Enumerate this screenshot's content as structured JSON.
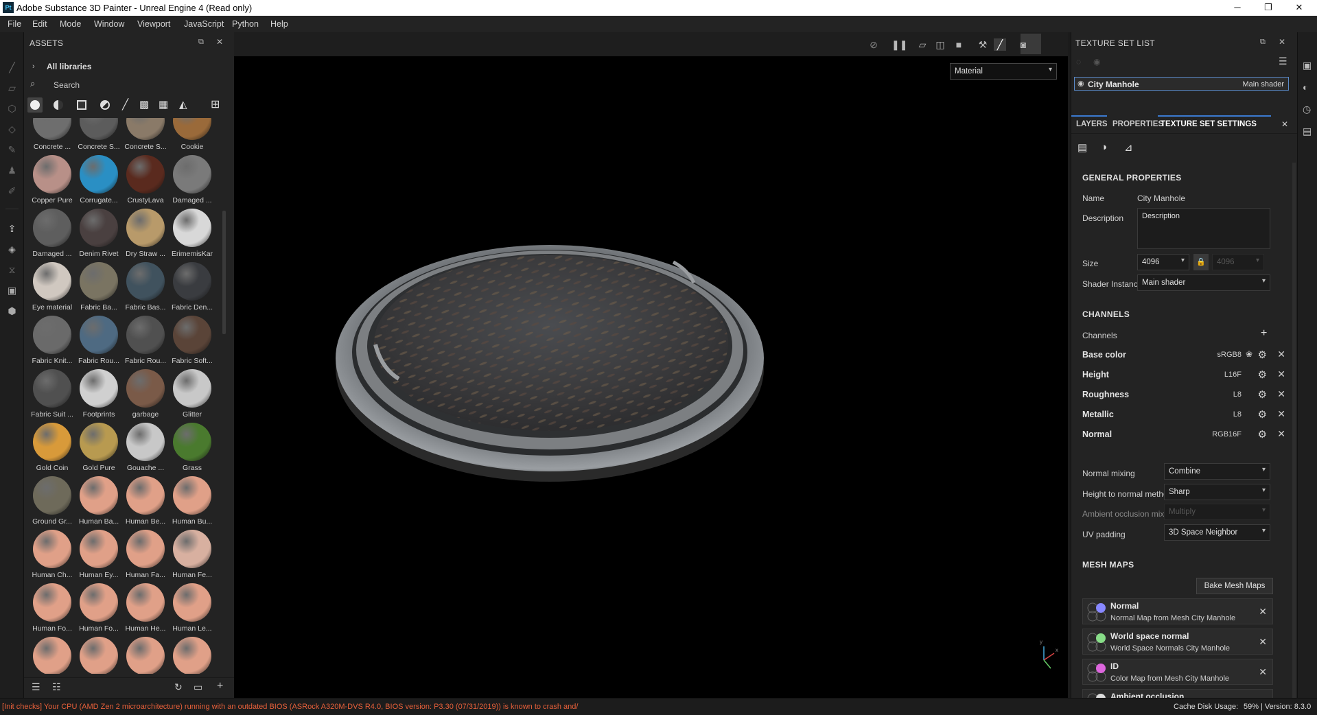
{
  "window": {
    "title": "Adobe Substance 3D Painter - Unreal Engine 4 (Read only)",
    "app_icon": "Pt",
    "minimize": "─",
    "maximize": "❐",
    "close": "✕"
  },
  "menu": [
    "File",
    "Edit",
    "Mode",
    "Window",
    "Viewport",
    "JavaScript",
    "Python",
    "Help"
  ],
  "assets": {
    "title": "ASSETS",
    "breadcrumb": "All libraries",
    "search_placeholder": "Search",
    "items": [
      {
        "label": "Concrete ...",
        "color": "#6e6e6e"
      },
      {
        "label": "Concrete S...",
        "color": "#5c5c5c"
      },
      {
        "label": "Concrete S...",
        "color": "#8a7a68"
      },
      {
        "label": "Cookie",
        "color": "#9a6a3a"
      },
      {
        "label": "Copper Pure",
        "color": "#b89088"
      },
      {
        "label": "Corrugate...",
        "color": "#2a8fc4"
      },
      {
        "label": "CrustyLava",
        "color": "#5a2a1e"
      },
      {
        "label": "Damaged ...",
        "color": "#7a7a7a"
      },
      {
        "label": "Damaged ...",
        "color": "#5e5e5e"
      },
      {
        "label": "Denim Rivet",
        "color": "#4a4040"
      },
      {
        "label": "Dry Straw ...",
        "color": "#b89a6a"
      },
      {
        "label": "ErimemisKar",
        "color": "#d8d8d8"
      },
      {
        "label": "Eye material",
        "color": "#d0c8c0"
      },
      {
        "label": "Fabric Ba...",
        "color": "#7a7462"
      },
      {
        "label": "Fabric Bas...",
        "color": "#40525e"
      },
      {
        "label": "Fabric Den...",
        "color": "#3a3c40"
      },
      {
        "label": "Fabric Knit...",
        "color": "#6a6a6a"
      },
      {
        "label": "Fabric Rou...",
        "color": "#4e6a82"
      },
      {
        "label": "Fabric Rou...",
        "color": "#505050"
      },
      {
        "label": "Fabric Soft...",
        "color": "#5a4438"
      },
      {
        "label": "Fabric Suit ...",
        "color": "#505050"
      },
      {
        "label": "Footprints",
        "color": "#d0d0d0"
      },
      {
        "label": "garbage",
        "color": "#7a5a48"
      },
      {
        "label": "Glitter",
        "color": "#c8c8c8"
      },
      {
        "label": "Gold Coin",
        "color": "#d89a3a"
      },
      {
        "label": "Gold Pure",
        "color": "#b89a50"
      },
      {
        "label": "Gouache ...",
        "color": "#c8c8c8"
      },
      {
        "label": "Grass",
        "color": "#4a7a2e"
      },
      {
        "label": "Ground Gr...",
        "color": "#6e6a5a"
      },
      {
        "label": "Human Ba...",
        "color": "#e0a088"
      },
      {
        "label": "Human Be...",
        "color": "#e0a088"
      },
      {
        "label": "Human Bu...",
        "color": "#e0a088"
      },
      {
        "label": "Human Ch...",
        "color": "#e0a088"
      },
      {
        "label": "Human Ey...",
        "color": "#e0a088"
      },
      {
        "label": "Human Fa...",
        "color": "#e0a088"
      },
      {
        "label": "Human Fe...",
        "color": "#d8b0a0"
      },
      {
        "label": "Human Fo...",
        "color": "#e0a088"
      },
      {
        "label": "Human Fo...",
        "color": "#e0a088"
      },
      {
        "label": "Human He...",
        "color": "#e0a088"
      },
      {
        "label": "Human Le...",
        "color": "#e0a088"
      },
      {
        "label": "",
        "color": "#e0a088"
      },
      {
        "label": "",
        "color": "#e0a088"
      },
      {
        "label": "",
        "color": "#e0a088"
      },
      {
        "label": "",
        "color": "#e0a088"
      }
    ]
  },
  "viewport": {
    "mode_select": "Material",
    "axis_labels": {
      "x": "x",
      "y": "y"
    }
  },
  "tsl": {
    "title": "TEXTURE SET LIST",
    "item_name": "City Manhole",
    "item_shader": "Main shader"
  },
  "tabs": {
    "layers": "LAYERS",
    "properties": "PROPERTIES",
    "tss": "TEXTURE SET SETTINGS"
  },
  "tss": {
    "general_title": "GENERAL PROPERTIES",
    "name_label": "Name",
    "name_value": "City Manhole",
    "desc_label": "Description",
    "desc_value": "Description",
    "size_label": "Size",
    "size_value": "4096",
    "size_value2": "4096",
    "shader_label": "Shader Instance",
    "shader_value": "Main shader",
    "channels_title": "CHANNELS",
    "channels_label": "Channels",
    "channels": [
      {
        "name": "Base color",
        "format": "sRGB8"
      },
      {
        "name": "Height",
        "format": "L16F"
      },
      {
        "name": "Roughness",
        "format": "L8"
      },
      {
        "name": "Metallic",
        "format": "L8"
      },
      {
        "name": "Normal",
        "format": "RGB16F"
      }
    ],
    "normal_mixing_label": "Normal mixing",
    "normal_mixing_value": "Combine",
    "h2n_label": "Height to normal method",
    "h2n_value": "Sharp",
    "ao_label": "Ambient occlusion mixing",
    "ao_value": "Multiply",
    "uv_label": "UV padding",
    "uv_value": "3D Space Neighbor",
    "mesh_title": "MESH MAPS",
    "bake_button": "Bake Mesh Maps",
    "mesh_maps": [
      {
        "name": "Normal",
        "desc": "Normal Map from Mesh City Manhole",
        "color": "#8888ff"
      },
      {
        "name": "World space normal",
        "desc": "World Space Normals City Manhole",
        "color": "#88dd88"
      },
      {
        "name": "ID",
        "desc": "Color Map from Mesh City Manhole",
        "color": "#dd66dd"
      },
      {
        "name": "Ambient occlusion",
        "desc": "",
        "color": "#dddddd"
      }
    ]
  },
  "status": {
    "message": "[Init checks] Your CPU (AMD Zen 2 microarchitecture) running with an outdated BIOS (ASRock A320M-DVS R4.0, BIOS version: P3.30 (07/31/2019)) is known to crash and/or ...",
    "cache": "Cache Disk Usage:",
    "cache_pct": "59%",
    "version": "| Version: 8.3.0"
  }
}
